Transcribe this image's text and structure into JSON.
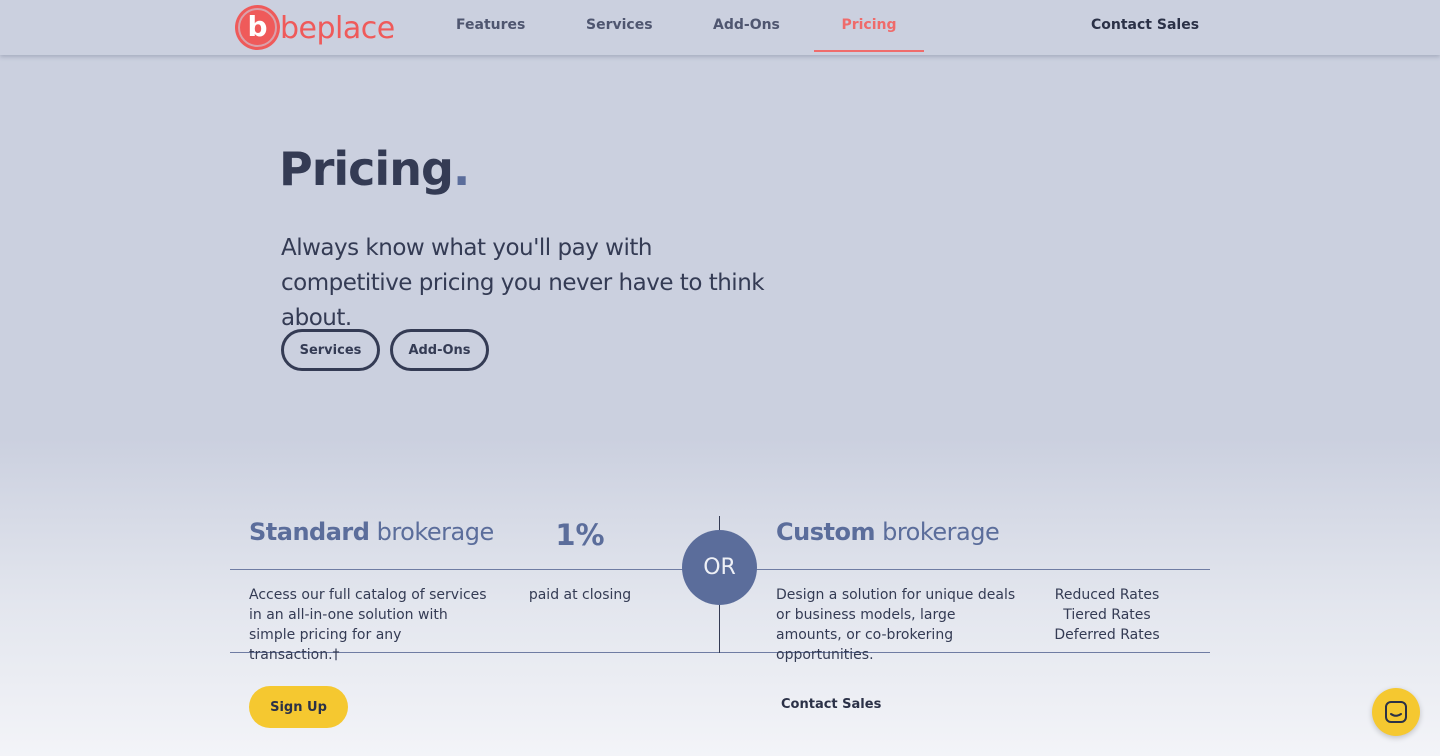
{
  "brand": {
    "logo_letter": "b",
    "name": "beplace",
    "color": "#ef5a5a"
  },
  "nav": {
    "features": "Features",
    "services": "Services",
    "addons": "Add-Ons",
    "pricing": "Pricing",
    "contact": "Contact Sales"
  },
  "hero": {
    "title": "Pricing",
    "title_dot": ".",
    "subtitle": "Always know what you'll pay with competitive pricing you never have to think about.",
    "btn_services": "Services",
    "btn_addons": "Add-Ons"
  },
  "standard": {
    "title_bold": "Standard",
    "title_rest": "brokerage",
    "rate": "1%",
    "description": "Access our full catalog of services in an all-in-one solution with simple pricing for any transaction.†",
    "rate_note": "paid at closing",
    "cta": "Sign Up"
  },
  "separator": "OR",
  "custom": {
    "title_bold": "Custom",
    "title_rest": "brokerage",
    "description": "Design a solution for unique deals or business models, large amounts, or co-brokering opportunities.",
    "rates": [
      "Reduced Rates",
      "Tiered Rates",
      "Deferred Rates"
    ],
    "cta": "Contact Sales"
  },
  "colors": {
    "accent": "#5b6d9b",
    "yellow": "#f5c830",
    "dark": "#343b54",
    "active": "#ef6b6b"
  }
}
